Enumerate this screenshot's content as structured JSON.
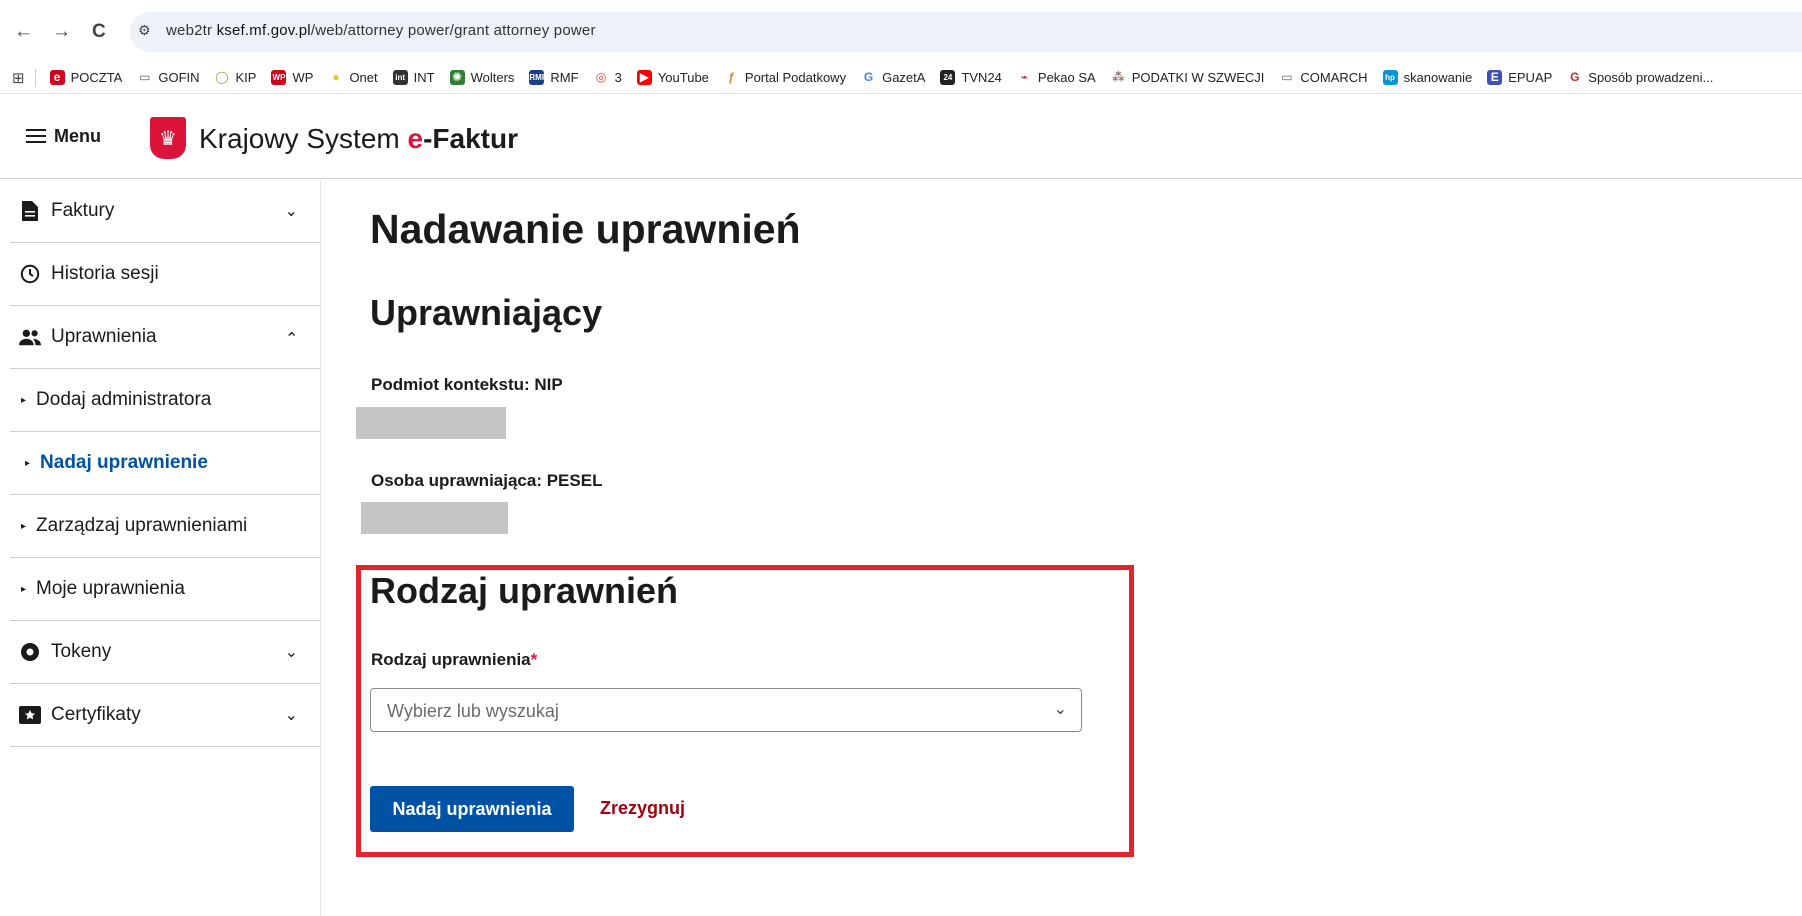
{
  "browser": {
    "back_icon": "←",
    "forward_icon": "→",
    "reload_icon": "C",
    "url_prefix": "web2tr ",
    "url_domain": "ksef.mf.gov.pl",
    "url_path": "/web/attorney power/grant attorney power",
    "bookmarks": [
      {
        "label": "POCZTA",
        "icon": "e",
        "color": "#d0021b"
      },
      {
        "label": "GOFIN",
        "icon": "▭",
        "color": "#666666"
      },
      {
        "label": "KIP",
        "icon": "◯",
        "color": "#7cb342"
      },
      {
        "label": "WP",
        "icon": "WP",
        "color": "#d0021b"
      },
      {
        "label": "Onet",
        "icon": "●",
        "color": "#f5c518"
      },
      {
        "label": "INT",
        "icon": "int",
        "color": "#333333"
      },
      {
        "label": "Wolters",
        "icon": "✺",
        "color": "#2e7d32"
      },
      {
        "label": "RMF",
        "icon": "RMF",
        "color": "#1a3e8a"
      },
      {
        "label": "3",
        "icon": "◎",
        "color": "#e53935"
      },
      {
        "label": "YouTube",
        "icon": "▶",
        "color": "#ff0000"
      },
      {
        "label": "Portal Podatkowy",
        "icon": "ƒ",
        "color": "#e67e22"
      },
      {
        "label": "GazetA",
        "icon": "G",
        "color": "#4285f4"
      },
      {
        "label": "TVN24",
        "icon": "24",
        "color": "#222222"
      },
      {
        "label": "Pekao SA",
        "icon": "⌁",
        "color": "#d0021b"
      },
      {
        "label": "PODATKI W SZWECJI",
        "icon": "⁂",
        "color": "#8d6e63"
      },
      {
        "label": "COMARCH",
        "icon": "▭",
        "color": "#666666"
      },
      {
        "label": "skanowanie",
        "icon": "hp",
        "color": "#0096d6"
      },
      {
        "label": "EPUAP",
        "icon": "E",
        "color": "#3f51b5"
      },
      {
        "label": "Sposób prowadzeni...",
        "icon": "G",
        "color": "#c62828"
      }
    ]
  },
  "header": {
    "menu_label": "Menu",
    "brand_text": "Krajowy System",
    "brand_accent_e": "e",
    "brand_accent_rest": "-Faktur"
  },
  "sidebar": {
    "items": [
      {
        "label": "Faktury",
        "icon": "document-icon",
        "chevron": "chevron-down-icon"
      },
      {
        "label": "Historia sesji",
        "icon": "clock-icon"
      },
      {
        "label": "Uprawnienia",
        "icon": "users-icon",
        "chevron": "chevron-up-icon"
      },
      {
        "label": "Dodaj administratora"
      },
      {
        "label": "Nadaj uprawnienie",
        "active": true
      },
      {
        "label": "Zarządzaj uprawnieniami"
      },
      {
        "label": "Moje uprawnienia"
      },
      {
        "label": "Tokeny",
        "icon": "token-icon",
        "chevron": "chevron-down-icon"
      },
      {
        "label": "Certyfikaty",
        "icon": "certificate-icon",
        "chevron": "chevron-down-icon"
      }
    ]
  },
  "main": {
    "page_title": "Nadawanie uprawnień",
    "section_grantor": "Uprawniający",
    "context_label": "Podmiot kontekstu: NIP",
    "person_label": "Osoba uprawniająca: PESEL",
    "section_type": "Rodzaj uprawnień",
    "type_field_label": "Rodzaj uprawnienia",
    "required_mark": "*",
    "select_placeholder": "Wybierz lub wyszukaj",
    "submit_label": "Nadaj uprawnienia",
    "cancel_label": "Zrezygnuj"
  },
  "colors": {
    "primary": "#0052a5",
    "danger_link": "#a3000b",
    "highlight": "#e3242b"
  }
}
